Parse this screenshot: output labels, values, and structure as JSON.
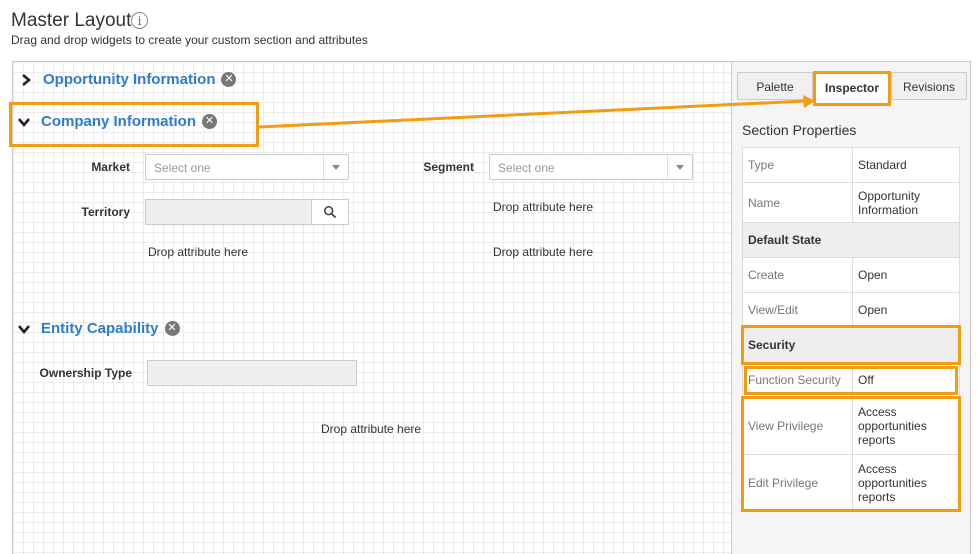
{
  "header": {
    "title": "Master Layout",
    "info_icon": "info-icon",
    "subtitle": "Drag and drop widgets to create your custom section and attributes"
  },
  "sections": [
    {
      "title": "Opportunity Information",
      "state": "collapsed"
    },
    {
      "title": "Company Information",
      "state": "expanded",
      "fields": {
        "market_label": "Market",
        "market_placeholder": "Select one",
        "segment_label": "Segment",
        "segment_placeholder": "Select one",
        "territory_label": "Territory",
        "drop_1": "Drop attribute here",
        "drop_2": "Drop attribute here",
        "drop_3": "Drop attribute here"
      }
    },
    {
      "title": "Entity Capability",
      "state": "expanded",
      "fields": {
        "ownership_label": "Ownership Type",
        "drop_1": "Drop attribute here"
      }
    }
  ],
  "tabs": [
    {
      "label": "Palette",
      "active": false
    },
    {
      "label": "Inspector",
      "active": true
    },
    {
      "label": "Revisions",
      "active": false
    }
  ],
  "inspector": {
    "title": "Section Properties",
    "rows": {
      "type": {
        "key": "Type",
        "value": "Standard"
      },
      "name": {
        "key": "Name",
        "value": "Opportunity Information"
      },
      "default_state": "Default State",
      "create": {
        "key": "Create",
        "value": "Open"
      },
      "view_edit": {
        "key": "View/Edit",
        "value": "Open"
      },
      "security": "Security",
      "function_security": {
        "key": "Function Security",
        "value": "Off"
      },
      "view_privilege": {
        "key": "View Privilege",
        "value": "Access opportunities reports"
      },
      "edit_privilege": {
        "key": "Edit Privilege",
        "value": "Access opportunities reports"
      }
    }
  },
  "colors": {
    "section_title": "#2f7bd2",
    "highlight": "#f39c12"
  }
}
